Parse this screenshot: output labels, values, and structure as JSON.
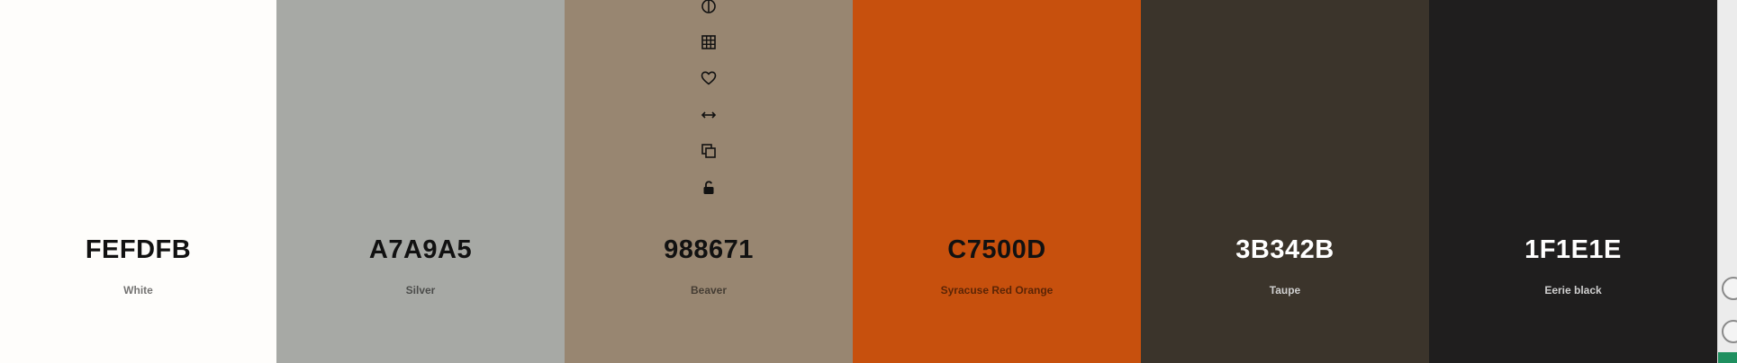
{
  "palette": {
    "swatches": [
      {
        "hex": "FEFDFB",
        "name": "White",
        "color": "#FEFDFB"
      },
      {
        "hex": "A7A9A5",
        "name": "Silver",
        "color": "#A7A9A5"
      },
      {
        "hex": "988671",
        "name": "Beaver",
        "color": "#988671"
      },
      {
        "hex": "C7500D",
        "name": "Syracuse Red Orange",
        "color": "#C7500D"
      },
      {
        "hex": "3B342B",
        "name": "Taupe",
        "color": "#3B342B"
      },
      {
        "hex": "1F1E1E",
        "name": "Eerie black",
        "color": "#1F1E1E"
      }
    ]
  },
  "toolbar": {
    "icons": [
      "contrast-icon",
      "grid-icon",
      "heart-icon",
      "arrows-horizontal-icon",
      "copy-icon",
      "unlock-icon"
    ]
  },
  "rightbar": {
    "accent": "#1F8F5F"
  }
}
